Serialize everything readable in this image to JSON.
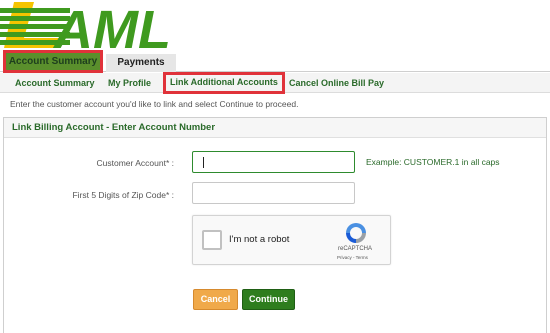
{
  "brand": {
    "name": "AML",
    "colors": {
      "green": "#3f9a1f",
      "yellow": "#f5c400",
      "nav_green": "#2a6a2a",
      "highlight_red": "#e0323a"
    }
  },
  "tabs": [
    {
      "label": "Account Summary",
      "active": true
    },
    {
      "label": "Payments",
      "active": false
    }
  ],
  "subnav": [
    {
      "label": "Account Summary"
    },
    {
      "label": "My Profile"
    },
    {
      "label": "Link Additional Accounts",
      "highlighted": true
    },
    {
      "label": "Cancel Online Bill Pay"
    }
  ],
  "instruction": "Enter the customer account you'd like to link and select Continue to proceed.",
  "panel": {
    "title": "Link Billing Account - Enter Account Number",
    "customer_account": {
      "label": "Customer Account* :",
      "value": "",
      "example": "Example: CUSTOMER.1 in all caps"
    },
    "zip": {
      "label": "First 5 Digits of Zip Code* :",
      "value": ""
    }
  },
  "captcha": {
    "label": "I'm not a robot",
    "brand": "reCAPTCHA",
    "links": "Privacy - Terms",
    "checked": false
  },
  "buttons": {
    "cancel": "Cancel",
    "continue": "Continue"
  }
}
